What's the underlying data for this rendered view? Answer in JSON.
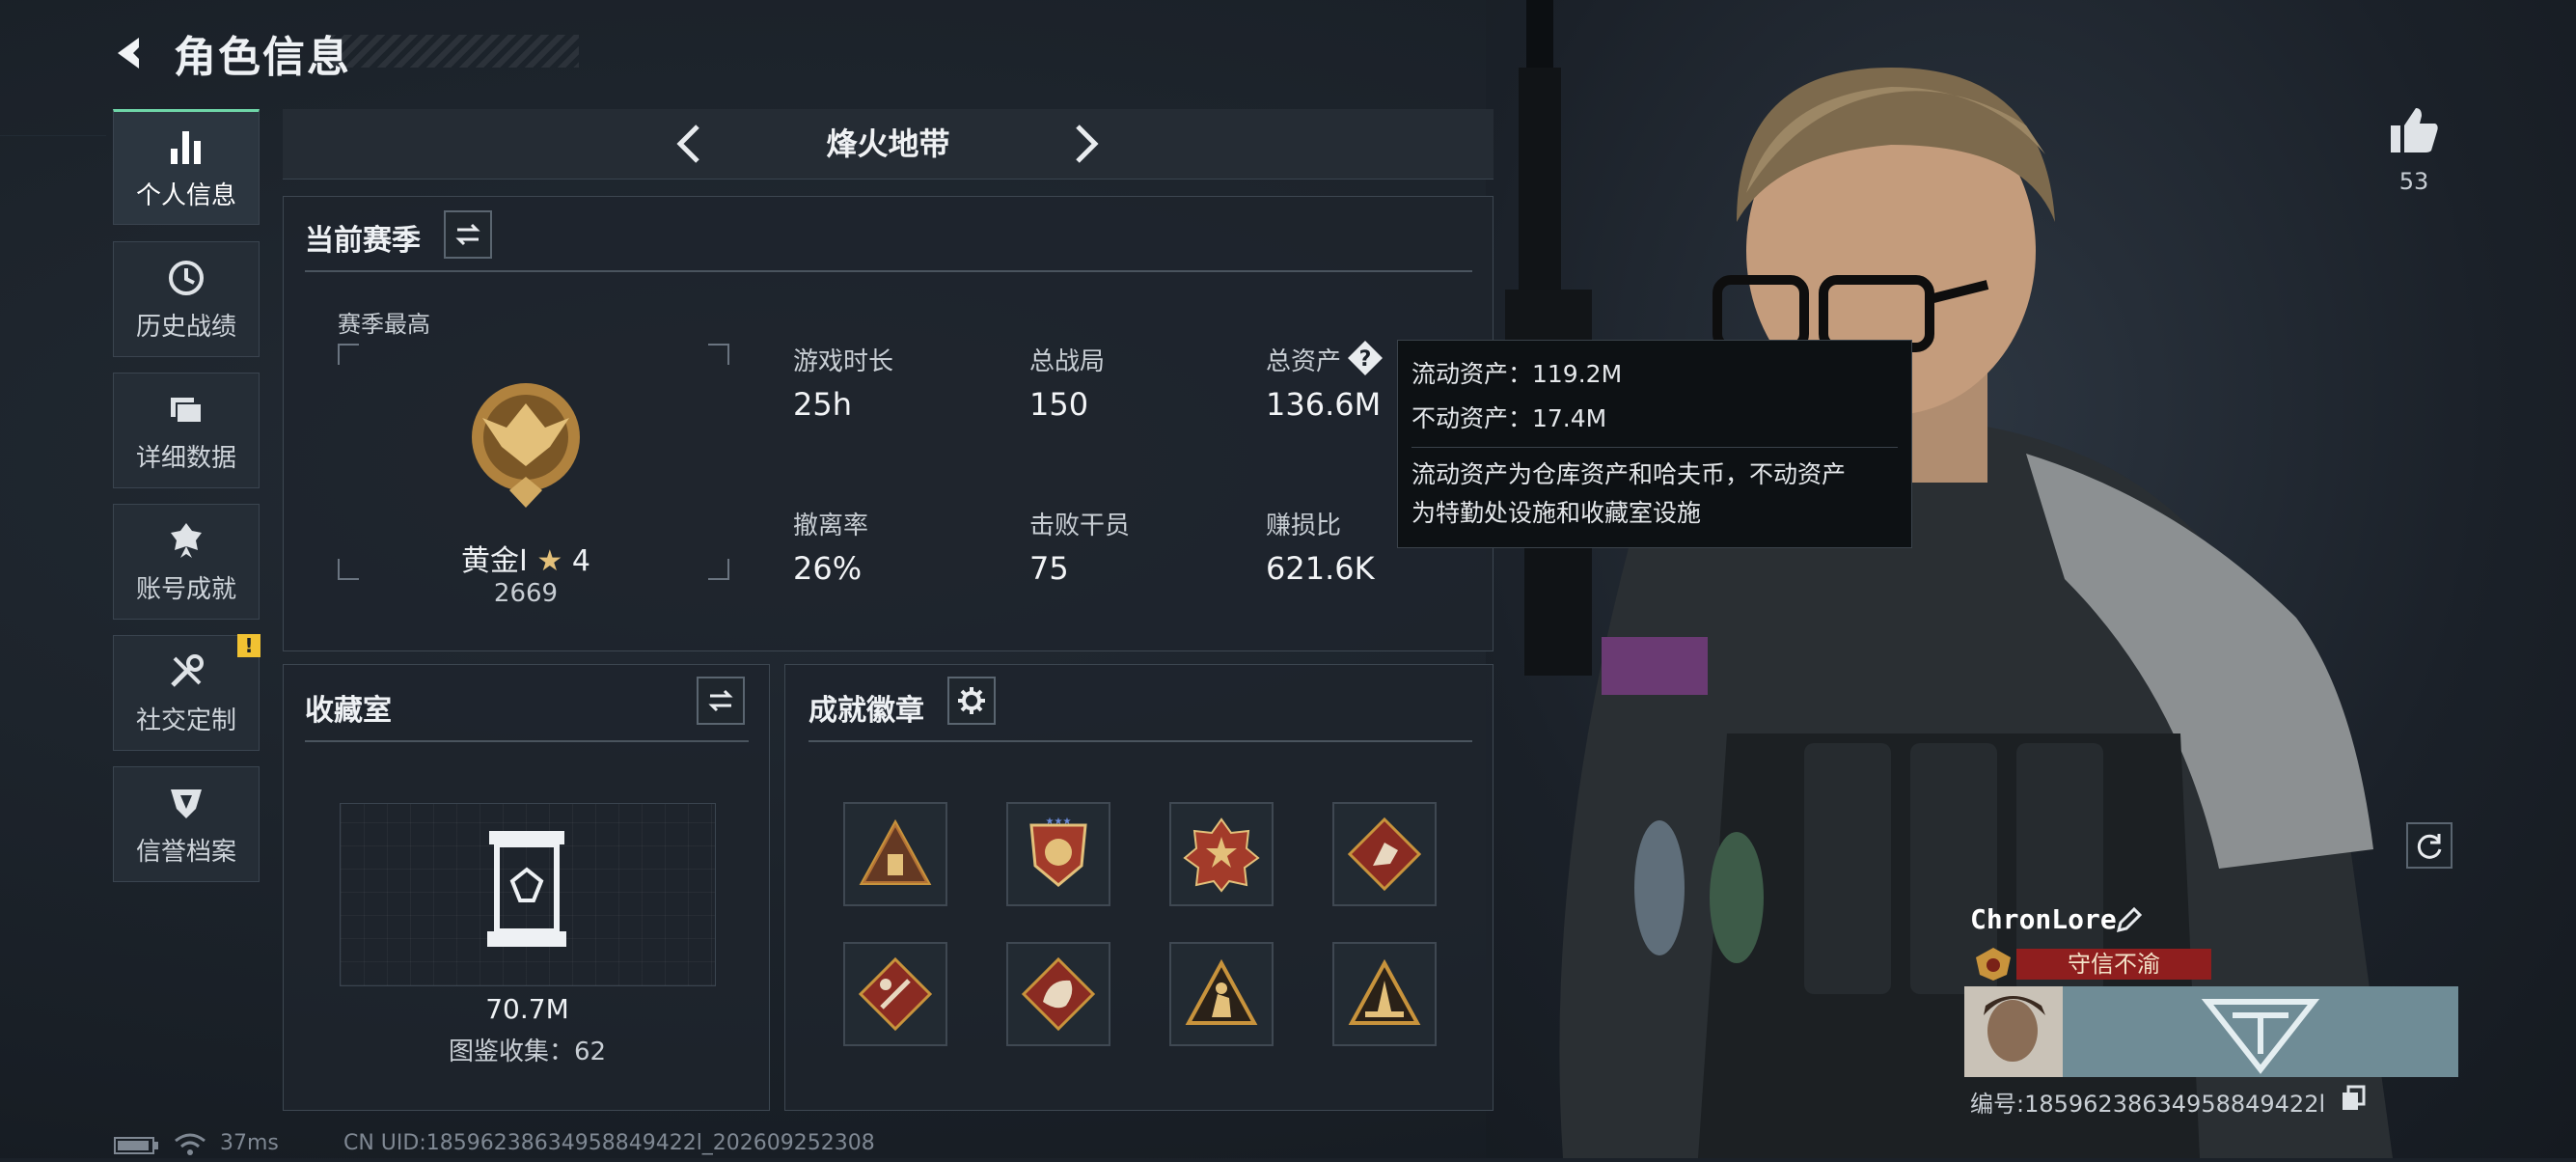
{
  "header": {
    "title": "角色信息"
  },
  "sidebar": {
    "items": [
      {
        "label": "个人信息",
        "icon": "bar-chart-icon",
        "active": true
      },
      {
        "label": "历史战绩",
        "icon": "clock-history-icon"
      },
      {
        "label": "详细数据",
        "icon": "folder-icon"
      },
      {
        "label": "账号成就",
        "icon": "medal-icon"
      },
      {
        "label": "社交定制",
        "icon": "tools-icon",
        "alert": "!"
      },
      {
        "label": "信誉档案",
        "icon": "shield-icon"
      }
    ]
  },
  "mode": {
    "name": "烽火地带"
  },
  "season": {
    "title": "当前赛季",
    "best_label": "赛季最高",
    "rank_name": "黄金Ⅰ",
    "rank_stars": "4",
    "rank_score": "2669",
    "stats": [
      {
        "label": "游戏时长",
        "value": "25h"
      },
      {
        "label": "总战局",
        "value": "150"
      },
      {
        "label": "总资产",
        "value": "136.6M"
      },
      {
        "label": "撤离率",
        "value": "26%"
      },
      {
        "label": "击败干员",
        "value": "75"
      },
      {
        "label": "赚损比",
        "value": "621.6K"
      }
    ]
  },
  "tooltip": {
    "liquid": "流动资产：119.2M",
    "fixed": "不动资产：17.4M",
    "desc_line1": "流动资产为仓库资产和哈夫币，不动资产",
    "desc_line2": "为特勤处设施和收藏室设施"
  },
  "collection": {
    "title": "收藏室",
    "value": "70.7M",
    "catalog": "图鉴收集：62"
  },
  "achievements": {
    "title": "成就徽章",
    "badges": [
      "badge-1",
      "badge-2",
      "badge-3",
      "badge-4",
      "badge-5",
      "badge-6",
      "badge-7",
      "badge-8"
    ]
  },
  "profile": {
    "likes": "53",
    "name": "ChronLore",
    "title_tag": "守信不渝",
    "uid": "编号:18596238634958849422l"
  },
  "statusbar": {
    "ping": "37ms",
    "cn_uid": "CN UID:18596238634958849422l_202609252308"
  },
  "colors": {
    "accent": "#6fd6a8",
    "tag_red": "#9c1f1f",
    "alert": "#f1c232"
  }
}
